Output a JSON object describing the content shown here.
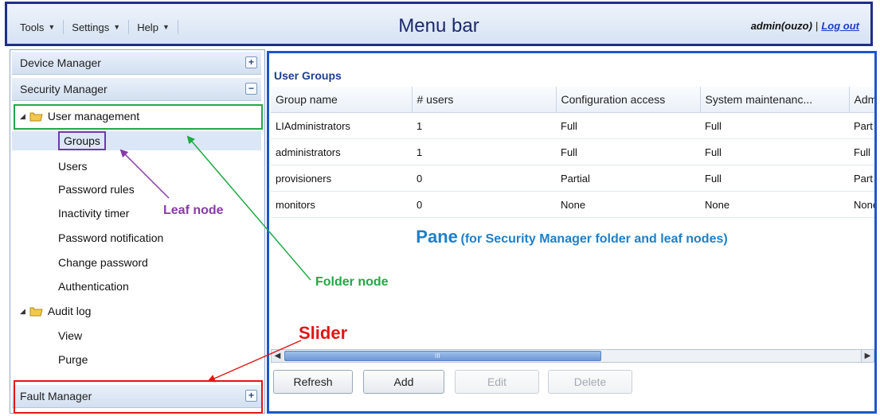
{
  "menubar": {
    "menus": [
      {
        "label": "Tools"
      },
      {
        "label": "Settings"
      },
      {
        "label": "Help"
      }
    ],
    "title": "Menu bar",
    "user": "admin(ouzo)",
    "separator": "|",
    "logout": "Log out"
  },
  "nav": {
    "device_manager": "Device Manager",
    "security_manager": "Security Manager",
    "fault_manager": "Fault Manager",
    "tree": {
      "user_management": "User management",
      "user_management_items": [
        "Groups",
        "Users",
        "Password rules",
        "Inactivity timer",
        "Password notification",
        "Change password",
        "Authentication"
      ],
      "audit_log": "Audit log",
      "audit_log_items": [
        "View",
        "Purge"
      ]
    },
    "expand_symbol": "+",
    "collapse_symbol": "−"
  },
  "pane": {
    "title": "User Groups",
    "columns": [
      "Group name",
      "# users",
      "Configuration access",
      "System maintenanc...",
      "Adm"
    ],
    "rows": [
      [
        "LIAdministrators",
        "1",
        "Full",
        "Full",
        "Part"
      ],
      [
        "administrators",
        "1",
        "Full",
        "Full",
        "Full"
      ],
      [
        "provisioners",
        "0",
        "Partial",
        "Full",
        "Part"
      ],
      [
        "monitors",
        "0",
        "None",
        "None",
        "None"
      ]
    ],
    "caption_main": "Pane",
    "caption_sub": "(for Security Manager folder and leaf nodes)",
    "buttons": {
      "refresh": "Refresh",
      "add": "Add",
      "edit": "Edit",
      "delete": "Delete"
    },
    "scroll_grip": "III"
  },
  "annotations": {
    "leaf": "Leaf node",
    "folder": "Folder node",
    "slider": "Slider"
  },
  "colors": {
    "menubar_border": "#1f2f86",
    "pane_border": "#1d57c8",
    "leaf_annotation": "#8a3aa8",
    "folder_annotation": "#22a845",
    "slider_annotation": "#e01616",
    "caption": "#1f7fc8"
  },
  "icons": {
    "menu_caret": "caret-down-icon",
    "folder": "folder-icon",
    "tree_expander": "triangle-expanded-icon",
    "accordion_expand": "plus-icon",
    "accordion_collapse": "minus-icon",
    "scroll_left": "arrow-left-icon",
    "scroll_right": "arrow-right-icon"
  }
}
